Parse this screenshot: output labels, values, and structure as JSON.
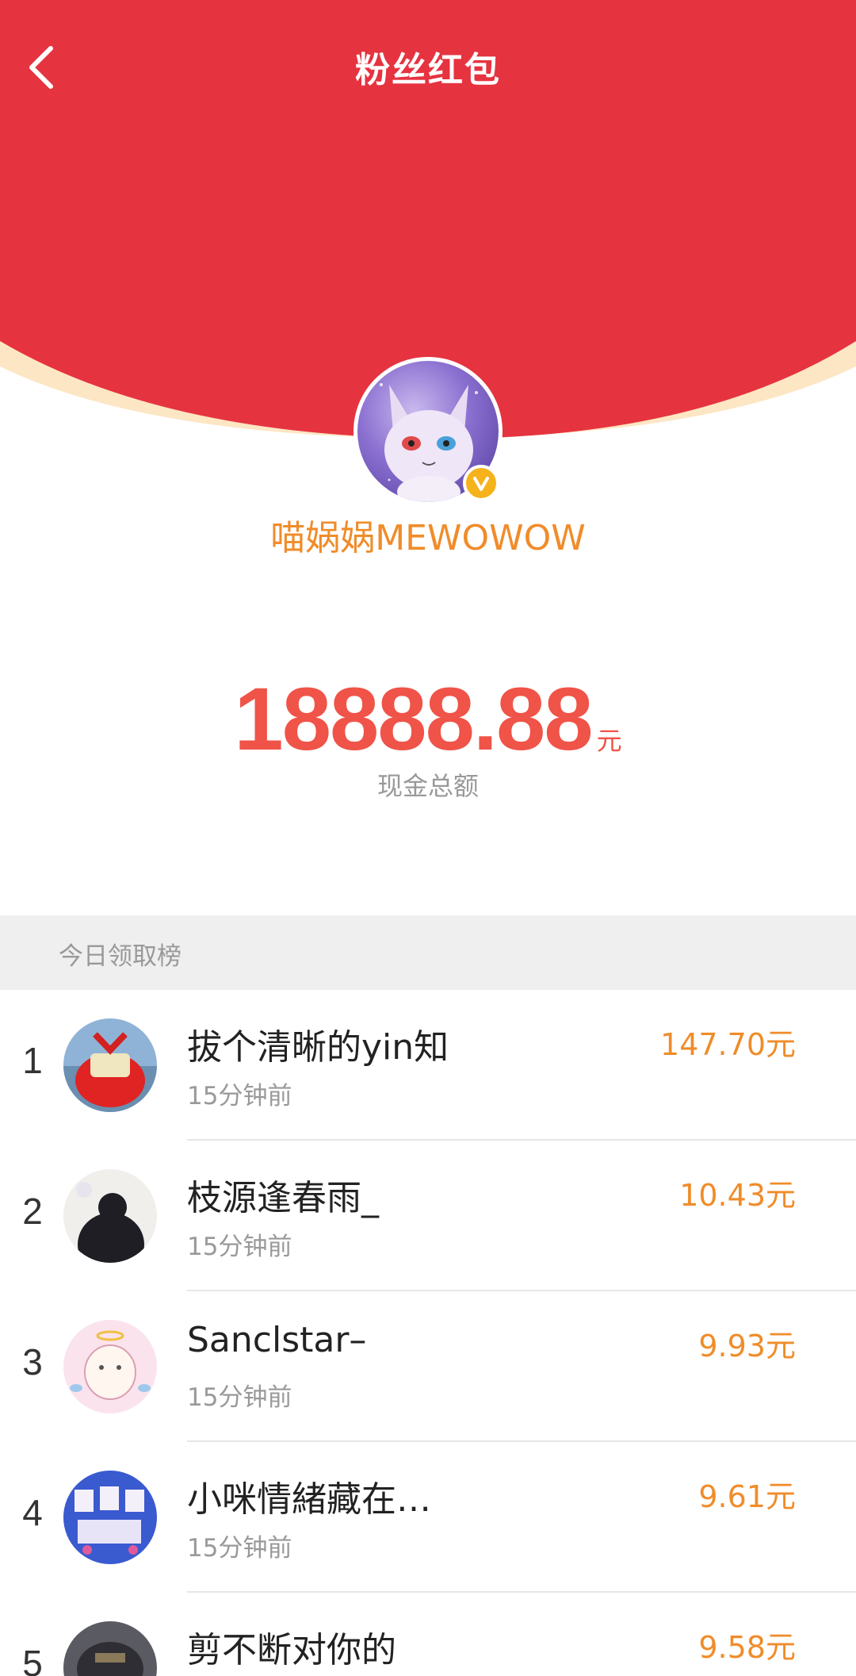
{
  "colors": {
    "header_red": "#e63340",
    "rim_cream": "#fde6c4",
    "accent_orange": "#f08c2a",
    "amount_red": "#f05348",
    "section_gray": "#efefef"
  },
  "header": {
    "title": "粉丝红包",
    "back_icon": "chevron-left-icon"
  },
  "sender": {
    "name": "喵娲娲MEWOWOW",
    "verified_icon": "verified-v-icon"
  },
  "total": {
    "amount": "18888.88",
    "unit": "元",
    "label": "现金总额"
  },
  "leaderboard": {
    "title": "今日领取榜",
    "rows": [
      {
        "rank": "1",
        "name": "拔个清晰的yin知",
        "time": "15分钟前",
        "amount": "147.70元"
      },
      {
        "rank": "2",
        "name": "枝源逢春雨_",
        "time": "15分钟前",
        "amount": "10.43元"
      },
      {
        "rank": "3",
        "name": "Sanclstar–",
        "time": "15分钟前",
        "amount": "9.93元"
      },
      {
        "rank": "4",
        "name": "小咪情緒藏在…",
        "time": "15分钟前",
        "amount": "9.61元"
      },
      {
        "rank": "5",
        "name": "剪不断对你的",
        "time": "",
        "amount": "9.58元"
      }
    ]
  }
}
